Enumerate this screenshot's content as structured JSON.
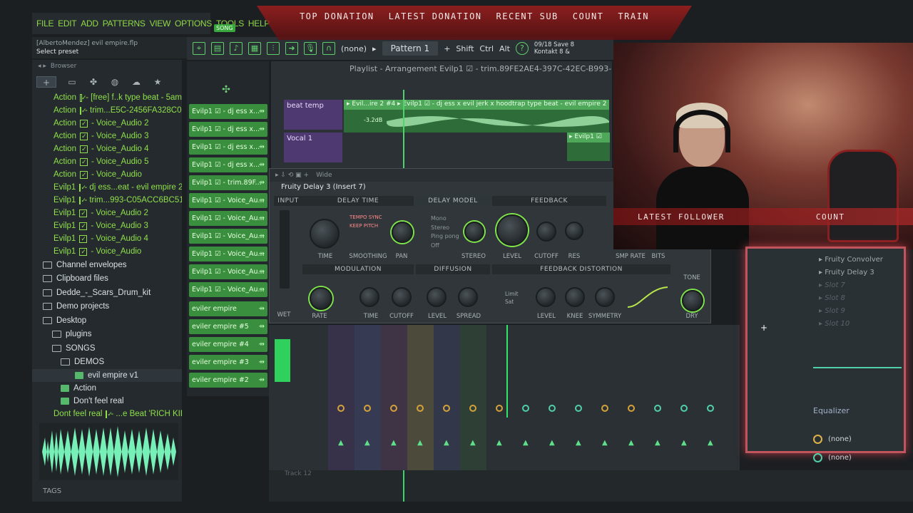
{
  "menu": [
    "FILE",
    "EDIT",
    "ADD",
    "PATTERNS",
    "VIEW",
    "OPTIONS",
    "TOOLS",
    "HELP"
  ],
  "song_badge": "SONG",
  "hint": {
    "project": "[AlbertoMendez] evil empire.flp",
    "status": "Select preset"
  },
  "browser": {
    "title": "Browser",
    "items": [
      {
        "text": "Action",
        "checked": true,
        "rest": "- [free] f..k type beat - 5am"
      },
      {
        "text": "Action",
        "checked": true,
        "rest": "- trim...E5C-2456FA328C06"
      },
      {
        "text": "Action",
        "checked": true,
        "rest": "- Voice_Audio 2"
      },
      {
        "text": "Action",
        "checked": true,
        "rest": "- Voice_Audio 3"
      },
      {
        "text": "Action",
        "checked": true,
        "rest": "- Voice_Audio 4"
      },
      {
        "text": "Action",
        "checked": true,
        "rest": "- Voice_Audio 5"
      },
      {
        "text": "Action",
        "checked": true,
        "rest": "- Voice_Audio"
      },
      {
        "text": "Evilp1",
        "checked": true,
        "rest": "- dj ess...eat - evil empire 2"
      },
      {
        "text": "Evilp1",
        "checked": true,
        "rest": "- trim...993-C05ACC6BC51F"
      },
      {
        "text": "Evilp1",
        "checked": true,
        "rest": "- Voice_Audio 2"
      },
      {
        "text": "Evilp1",
        "checked": true,
        "rest": "- Voice_Audio 3"
      },
      {
        "text": "Evilp1",
        "checked": true,
        "rest": "- Voice_Audio 4"
      },
      {
        "text": "Evilp1",
        "checked": true,
        "rest": "- Voice_Audio"
      }
    ],
    "folders": [
      {
        "text": "Channel envelopes",
        "indent": 0
      },
      {
        "text": "Clipboard files",
        "indent": 0
      },
      {
        "text": "Dedde_-_Scars_Drum_kit",
        "indent": 0
      },
      {
        "text": "Demo projects",
        "indent": 0
      },
      {
        "text": "Desktop",
        "indent": 0
      },
      {
        "text": "plugins",
        "indent": 1
      },
      {
        "text": "SONGS",
        "indent": 1
      },
      {
        "text": "DEMOS",
        "indent": 2
      }
    ],
    "files": [
      {
        "text": "evil empire v1",
        "indent": 3,
        "selected": true
      },
      {
        "text": "Action",
        "indent": 2
      },
      {
        "text": "Don't feel real",
        "indent": 2
      }
    ],
    "last_item": {
      "text": "Dont feel real",
      "rest": "- ...e Beat 'RICH KID'"
    },
    "tags_label": "TAGS"
  },
  "toolbar": {
    "none": "(none)",
    "pattern": "Pattern 1",
    "plus": "+",
    "shift": "Shift",
    "ctrl": "Ctrl",
    "alt": "Alt",
    "info_line1": "09/18  Save 8",
    "info_line2": "Kontakt 8 &"
  },
  "channels": [
    "Evilp1 ☑ - dj ess x...",
    "Evilp1 ☑ - dj ess x...",
    "Evilp1 ☑ - dj ess x...",
    "Evilp1 ☑ - dj ess x...",
    "Evilp1 ☑ - trim.89F...",
    "Evilp1 ☑ - Voice_Au...",
    "Evilp1 ☑ - Voice_Au...",
    "Evilp1 ☑ - Voice_Au...",
    "Evilp1 ☑ - Voice_Au...",
    "Evilp1 ☑ - Voice_Au...",
    "Evilp1 ☑ - Voice_Au...",
    "eviler empire",
    "eviler empire #5",
    "eviler empire #4",
    "eviler empire #3",
    "eviler empire #2"
  ],
  "playlist": {
    "title": "Playlist - Arrangement  Evilp1 ☑  - trim.89FE2AE4-397C-42EC-B993-",
    "tracks": [
      "beat temp",
      "Vocal 1"
    ],
    "clip_main": "▸ Evil...ire 2 #4 ▸ Evilp1 ☑ - dj ess x evil jerk x hoodtrap type beat - evil empire 2",
    "clip_db": "-3.2dB",
    "clip_vocal": "▸ Evilp1 ☑",
    "bottom_track": "Track 12"
  },
  "delay": {
    "toolbar_text": "Wide",
    "title": "Fruity Delay 3 (Insert 7)",
    "sections": {
      "input": "INPUT",
      "delay_time": "DELAY TIME",
      "delay_model": "DELAY MODEL",
      "feedback": "FEEDBACK",
      "modulation": "MODULATION",
      "diffusion": "DIFFUSION",
      "feedback_distortion": "FEEDBACK DISTORTION"
    },
    "options": {
      "tempo_sync": "TEMPO SYNC",
      "keep_pitch": "KEEP PITCH",
      "mono": "Mono",
      "stereo": "Stereo",
      "ping_pong": "Ping pong",
      "off": "Off",
      "limit": "Limit",
      "sat": "Sat"
    },
    "labels": {
      "time": "TIME",
      "smoothing": "SMOOTHING",
      "pan": "PAN",
      "stereo_k": "STEREO",
      "level": "LEVEL",
      "cutoff": "CUTOFF",
      "res": "RES",
      "smp_rate": "SMP RATE",
      "bits": "BITS",
      "tone": "TONE",
      "wet": "WET",
      "rate": "RATE",
      "mod_time": "TIME",
      "mod_cutoff": "CUTOFF",
      "diff_level": "LEVEL",
      "spread": "SPREAD",
      "fd_level": "LEVEL",
      "knee": "KNEE",
      "symmetry": "SYMMETRY",
      "dry": "DRY"
    }
  },
  "stream": {
    "top_labels": [
      "TOP DONATION",
      "LATEST DONATION",
      "RECENT SUB",
      "COUNT",
      "TRAIN"
    ],
    "latest_follower": "LATEST FOLLOWER",
    "count": "COUNT"
  },
  "fx_slots": {
    "items": [
      "Fruity Convolver",
      "Fruity Delay 3",
      "Slot 7",
      "Slot 8",
      "Slot 9",
      "Slot 10"
    ],
    "equalizer": "Equalizer",
    "none_a": "(none)",
    "none_b": "(none)"
  },
  "colors": {
    "accent": "#8fe04a",
    "stream_red": "#a82020",
    "channel_green": "#3a8f3e"
  }
}
